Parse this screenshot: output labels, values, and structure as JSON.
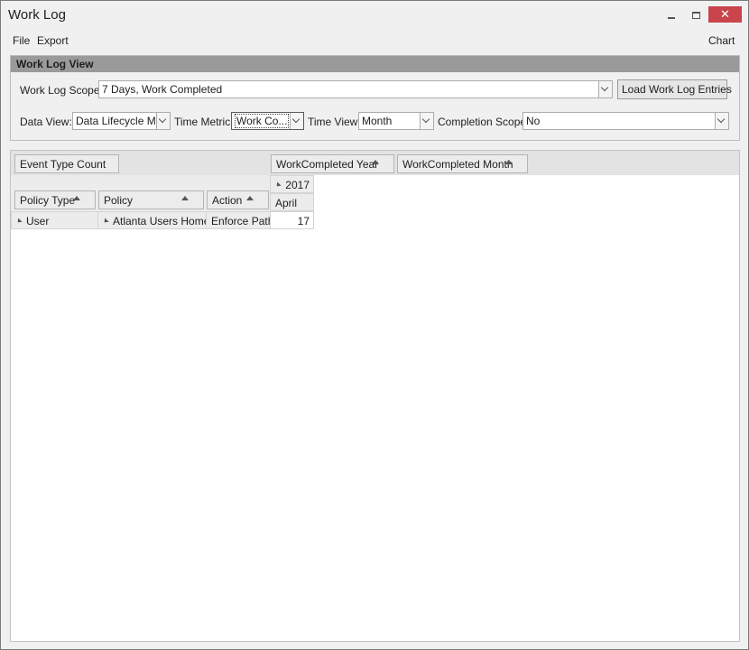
{
  "window": {
    "title": "Work Log"
  },
  "menu": {
    "file": "File",
    "export": "Export",
    "chart": "Chart"
  },
  "panel": {
    "header": "Work Log View",
    "scope_label": "Work Log Scope:",
    "scope_value": "7 Days, Work Completed",
    "load_button": "Load Work Log Entries",
    "data_view_label": "Data View:",
    "data_view_value": "Data Lifecycle M...",
    "time_metric_label": "Time Metric:",
    "time_metric_value": "Work Co...",
    "time_view_label": "Time View:",
    "time_view_value": "Month",
    "completion_scope_label": "Completion Scope:",
    "completion_scope_value": "No"
  },
  "pivot": {
    "data_field": "Event Type Count",
    "column_fields": [
      "WorkCompleted Year",
      "WorkCompleted Month"
    ],
    "row_fields": [
      "Policy Type",
      "Policy",
      "Action"
    ],
    "year": "2017",
    "month": "April",
    "rows": [
      {
        "policy_type": "User",
        "policy": "Atlanta Users Home",
        "action": "Enforce Path",
        "value": "17"
      }
    ]
  }
}
